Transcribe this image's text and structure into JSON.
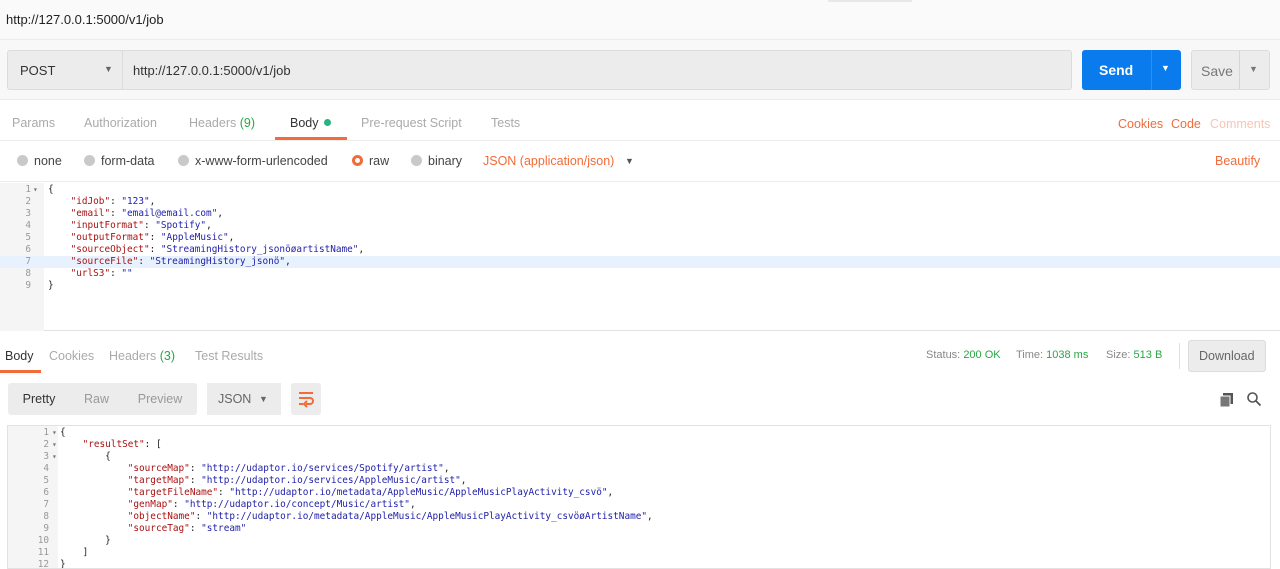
{
  "title_bar": {
    "text": "http://127.0.0.1:5000/v1/job"
  },
  "request": {
    "method": "POST",
    "url": "http://127.0.0.1:5000/v1/job",
    "send_label": "Send",
    "save_label": "Save"
  },
  "tabs": {
    "params": "Params",
    "authorization": "Authorization",
    "headers": "Headers",
    "headers_count": "(9)",
    "body": "Body",
    "prerequest": "Pre-request Script",
    "tests": "Tests",
    "cookies": "Cookies",
    "code": "Code",
    "comments": "Comments"
  },
  "body_options": {
    "none": "none",
    "form_data": "form-data",
    "urlencoded": "x-www-form-urlencoded",
    "raw": "raw",
    "binary": "binary",
    "content_type": "JSON (application/json)",
    "beautify": "Beautify",
    "selected": "raw"
  },
  "request_body": {
    "highlighted_line": 7,
    "lines": [
      {
        "n": "1",
        "fold": "▾",
        "text": "{"
      },
      {
        "n": "2",
        "fold": "",
        "text": "    \"idJob\": \"123\","
      },
      {
        "n": "3",
        "fold": "",
        "text": "    \"email\": \"email@email.com\","
      },
      {
        "n": "4",
        "fold": "",
        "text": "    \"inputFormat\": \"Spotify\","
      },
      {
        "n": "5",
        "fold": "",
        "text": "    \"outputFormat\": \"AppleMusic\","
      },
      {
        "n": "6",
        "fold": "",
        "text": "    \"sourceObject\": \"StreamingHistory_jsonöøartistName\","
      },
      {
        "n": "7",
        "fold": "",
        "text": "    \"sourceFile\": \"StreamingHistory_jsonö\","
      },
      {
        "n": "8",
        "fold": "",
        "text": "    \"urlS3\": \"\""
      },
      {
        "n": "9",
        "fold": "",
        "text": "}"
      }
    ]
  },
  "response_tabs": {
    "body": "Body",
    "cookies": "Cookies",
    "headers": "Headers",
    "headers_count": "(3)",
    "test_results": "Test Results"
  },
  "response_status": {
    "status_label": "Status:",
    "status_value": "200 OK",
    "time_label": "Time:",
    "time_value": "1038 ms",
    "size_label": "Size:",
    "size_value": "513 B",
    "download": "Download"
  },
  "response_view": {
    "pretty": "Pretty",
    "raw": "Raw",
    "preview": "Preview",
    "format": "JSON"
  },
  "response_body": {
    "lines": [
      {
        "n": "1",
        "fold": "▾",
        "text": "{"
      },
      {
        "n": "2",
        "fold": "▾",
        "text": "    \"resultSet\": ["
      },
      {
        "n": "3",
        "fold": "▾",
        "text": "        {"
      },
      {
        "n": "4",
        "fold": "",
        "text": "            \"sourceMap\": \"http://udaptor.io/services/Spotify/artist\","
      },
      {
        "n": "5",
        "fold": "",
        "text": "            \"targetMap\": \"http://udaptor.io/services/AppleMusic/artist\","
      },
      {
        "n": "6",
        "fold": "",
        "text": "            \"targetFileName\": \"http://udaptor.io/metadata/AppleMusic/AppleMusicPlayActivity_csvö\","
      },
      {
        "n": "7",
        "fold": "",
        "text": "            \"genMap\": \"http://udaptor.io/concept/Music/artist\","
      },
      {
        "n": "8",
        "fold": "",
        "text": "            \"objectName\": \"http://udaptor.io/metadata/AppleMusic/AppleMusicPlayActivity_csvöøArtistName\","
      },
      {
        "n": "9",
        "fold": "",
        "text": "            \"sourceTag\": \"stream\""
      },
      {
        "n": "10",
        "fold": "",
        "text": "        }"
      },
      {
        "n": "11",
        "fold": "",
        "text": "    ]"
      },
      {
        "n": "12",
        "fold": "",
        "text": "}"
      }
    ]
  },
  "colors": {
    "accent": "#f26b3a",
    "send": "#097bed",
    "success": "#28a745"
  }
}
